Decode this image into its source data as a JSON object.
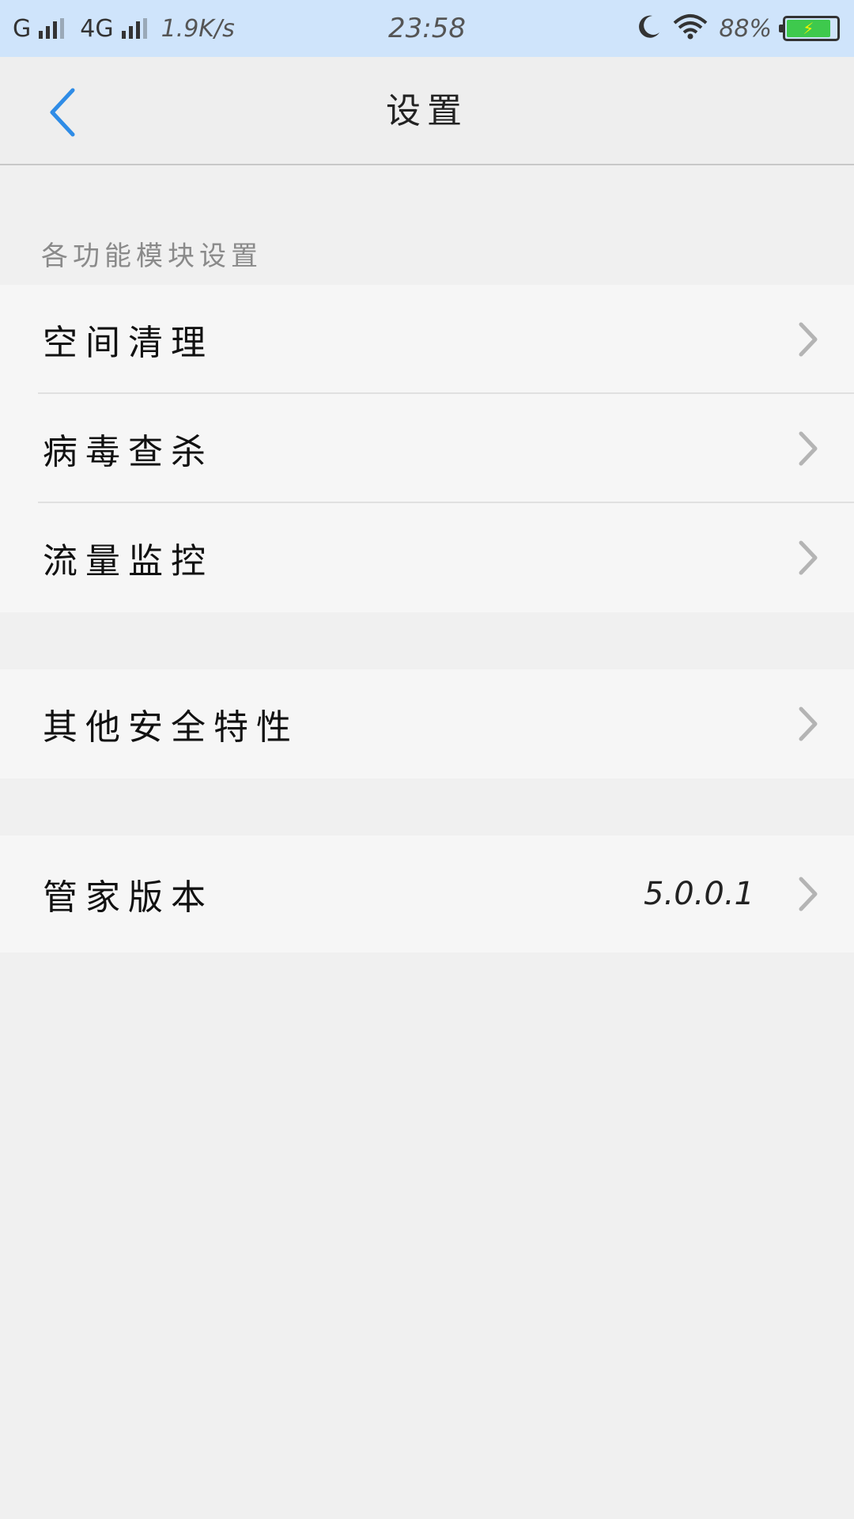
{
  "status_bar": {
    "network1": "G",
    "network2": "4G",
    "speed": "1.9K/s",
    "time": "23:58",
    "battery_percent": "88%",
    "battery_level": 0.88,
    "battery_charging": true
  },
  "header": {
    "title": "设置"
  },
  "section_caption": "各功能模块设置",
  "groups": [
    {
      "items": [
        {
          "label": "空间清理"
        },
        {
          "label": "病毒查杀"
        },
        {
          "label": "流量监控"
        }
      ]
    },
    {
      "items": [
        {
          "label": "其他安全特性"
        }
      ]
    },
    {
      "items": [
        {
          "label": "管家版本",
          "value": "5.0.0.1"
        }
      ]
    }
  ],
  "colors": {
    "status_bar_bg": "#cfe4fb",
    "accent_blue": "#2f8ce6",
    "battery_green": "#3ec94d",
    "chevron_gray": "#b4b4b4"
  },
  "icons": {
    "back": "chevron-left-icon",
    "row": "chevron-right-icon",
    "moon": "moon-icon",
    "wifi": "wifi-icon",
    "charging": "lightning-icon"
  }
}
